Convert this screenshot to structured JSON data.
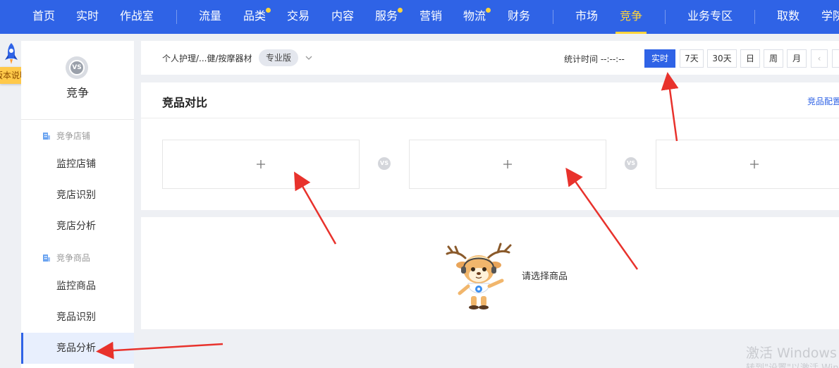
{
  "topnav": {
    "items": [
      "首页",
      "实时",
      "作战室",
      "流量",
      "品类",
      "交易",
      "内容",
      "服务",
      "营销",
      "物流",
      "财务",
      "市场",
      "竞争",
      "业务专区",
      "取数",
      "学院"
    ],
    "active": "竞争"
  },
  "guide": {
    "label": "版本说明"
  },
  "sidebar": {
    "title": "竞争",
    "logo_text": "VS",
    "groups": [
      "竞争店铺",
      "竞争商品"
    ],
    "items": [
      "监控店铺",
      "竞店识别",
      "竞店分析",
      "监控商品",
      "竞品识别",
      "竞品分析"
    ],
    "active": "竞品分析"
  },
  "filterbar": {
    "breadcrumb": "个人护理/...健/按摩器材",
    "edition": "专业版",
    "stat_time": "统计时间 --:--:--",
    "periods": [
      "实时",
      "7天",
      "30天",
      "日",
      "周",
      "月"
    ],
    "active_period": "实时",
    "prev": "‹"
  },
  "compare_card": {
    "title": "竞品对比",
    "config_link": "竞品配置",
    "vs_label": "VS",
    "slots": [
      "+",
      "+",
      "+"
    ]
  },
  "empty_card": {
    "message": "请选择商品"
  },
  "watermark": {
    "line1": "激活 Windows",
    "line2": "转到\"设置\"以激活 Windows。"
  },
  "colors": {
    "primary": "#2f63e6",
    "accent": "#ffd43b",
    "arrow": "#e8322c"
  }
}
